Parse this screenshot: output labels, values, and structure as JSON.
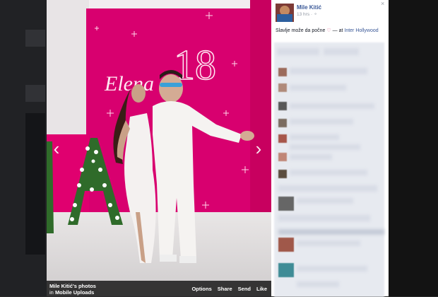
{
  "post": {
    "poster_name": "Mile Kitić",
    "time": "13 hrs · ⚬",
    "caption_text": "Slavlje može da počne",
    "heart": "♡",
    "at_text": "— at",
    "place": "Inter Hollywood"
  },
  "photo": {
    "banner_name": "Elena",
    "banner_number": "18"
  },
  "footer": {
    "album_owner": "Mile Kitić's photos",
    "album_in": "in",
    "album_name": "Mobile Uploads",
    "options": "Options",
    "share": "Share",
    "send": "Send",
    "like": "Like"
  },
  "icons": {
    "prev": "‹",
    "next": "›",
    "close": "×"
  },
  "colors": {
    "link": "#3b5998",
    "banner_pink": "#d8006f"
  }
}
